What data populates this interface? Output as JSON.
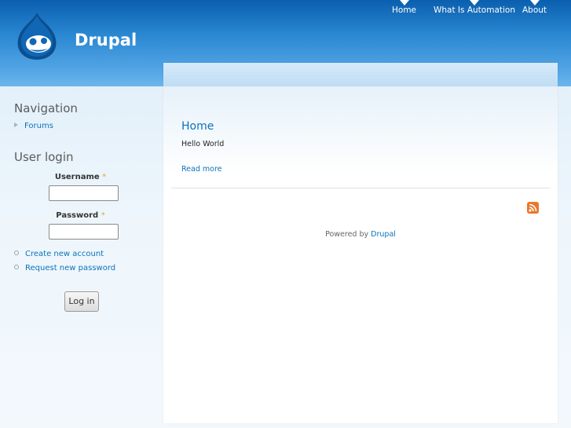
{
  "site": {
    "name": "Drupal",
    "logo_icon": "drupal-drop-icon"
  },
  "primary_links": [
    {
      "label": "Home"
    },
    {
      "label": "What Is Automation"
    },
    {
      "label": "About"
    }
  ],
  "sidebar": {
    "navigation": {
      "title": "Navigation",
      "items": [
        {
          "label": "Forums"
        }
      ]
    },
    "user_login": {
      "title": "User login",
      "username_label": "Username",
      "password_label": "Password",
      "required_marker": "*",
      "username_value": "",
      "password_value": "",
      "links": [
        {
          "label": "Create new account"
        },
        {
          "label": "Request new password"
        }
      ],
      "submit_label": "Log in"
    }
  },
  "main": {
    "node_title": "Home",
    "node_body": "Hello World",
    "read_more": "Read more",
    "feed_icon": "rss-icon",
    "footer_prefix": "Powered by",
    "footer_link": "Drupal"
  },
  "colors": {
    "link": "#0b73bb",
    "header_top": "#0a5fae",
    "header_bottom": "#6db6ec",
    "required": "#e4a33b",
    "rss": "#e36f1e"
  }
}
